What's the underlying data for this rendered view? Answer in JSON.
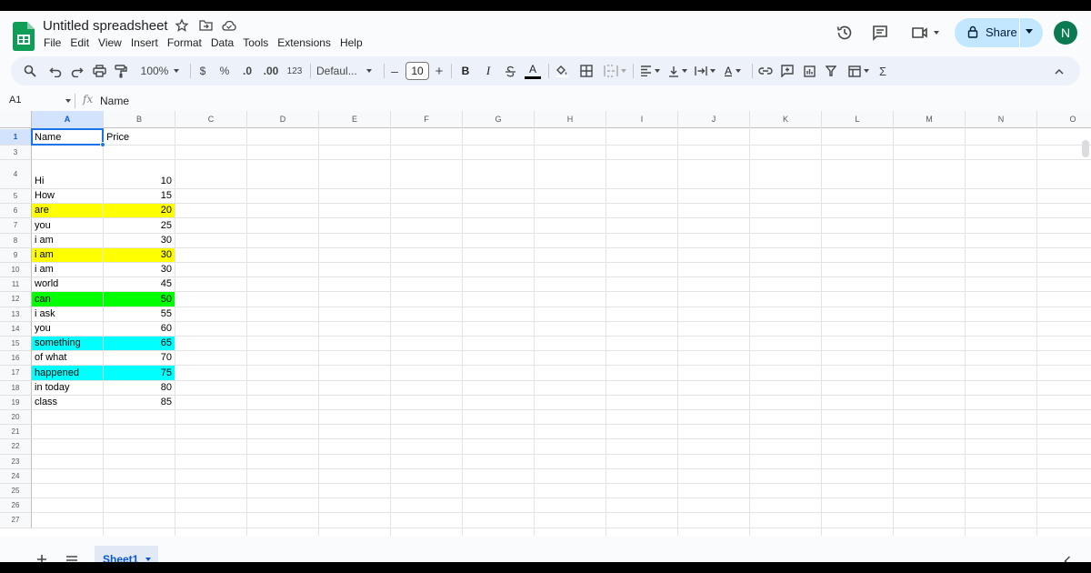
{
  "app": {
    "title": "Untitled spreadsheet",
    "menu": [
      "File",
      "Edit",
      "View",
      "Insert",
      "Format",
      "Data",
      "Tools",
      "Extensions",
      "Help"
    ],
    "share_label": "Share",
    "avatar_letter": "N",
    "brand_color": "#0f9d58",
    "accent_color": "#c2e7ff"
  },
  "toolbar": {
    "zoom": "100%",
    "currency": "$",
    "percent": "%",
    "decrease_decimal": ".0",
    "increase_decimal": ".00",
    "number_format": "123",
    "font": "Defaul...",
    "font_size": "10",
    "bold": "B",
    "italic": "I",
    "text_color_letter": "A",
    "rotate_letter": "A",
    "sigma": "Σ"
  },
  "formula_bar": {
    "cell_ref": "A1",
    "fx": "fx",
    "value": "Name"
  },
  "grid": {
    "columns": [
      "A",
      "B",
      "C",
      "D",
      "E",
      "F",
      "G",
      "H",
      "I",
      "J",
      "K",
      "L",
      "M",
      "N",
      "O"
    ],
    "row_labels": [
      "1",
      "3",
      "4",
      "5",
      "6",
      "7",
      "8",
      "9",
      "10",
      "11",
      "12",
      "13",
      "14",
      "15",
      "16",
      "17",
      "18",
      "19",
      "20",
      "21",
      "22",
      "23",
      "24",
      "25",
      "26",
      "27"
    ],
    "selected_cell": "A1",
    "rows": [
      {
        "a": "Name",
        "b": "Price",
        "fill": ""
      },
      {
        "a": "",
        "b": "",
        "fill": ""
      },
      {
        "a": "Hi",
        "b": "10",
        "fill": ""
      },
      {
        "a": "How",
        "b": "15",
        "fill": ""
      },
      {
        "a": "are",
        "b": "20",
        "fill": "#ffff00"
      },
      {
        "a": "you",
        "b": "25",
        "fill": ""
      },
      {
        "a": "i am",
        "b": "30",
        "fill": ""
      },
      {
        "a": "i am",
        "b": "30",
        "fill": "#ffff00"
      },
      {
        "a": "i am",
        "b": "30",
        "fill": ""
      },
      {
        "a": "world",
        "b": "45",
        "fill": ""
      },
      {
        "a": "can",
        "b": "50",
        "fill": "#00ff00"
      },
      {
        "a": "i ask",
        "b": "55",
        "fill": ""
      },
      {
        "a": "you",
        "b": "60",
        "fill": ""
      },
      {
        "a": "something",
        "b": "65",
        "fill": "#00ffff"
      },
      {
        "a": "of what",
        "b": "70",
        "fill": ""
      },
      {
        "a": "happened",
        "b": "75",
        "fill": "#00ffff"
      },
      {
        "a": "in today",
        "b": "80",
        "fill": ""
      },
      {
        "a": "class",
        "b": "85",
        "fill": ""
      }
    ]
  },
  "sheets": {
    "active": "Sheet1"
  }
}
